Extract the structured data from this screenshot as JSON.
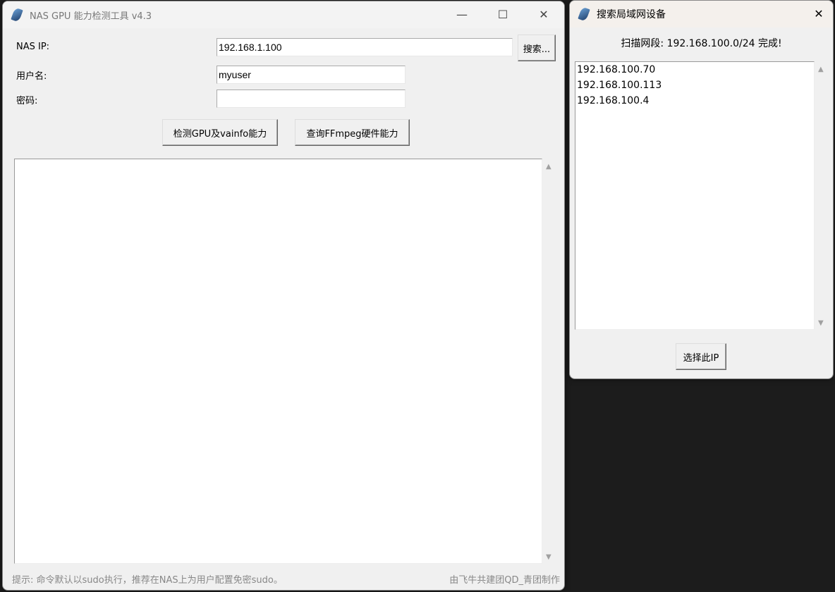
{
  "main": {
    "title": "NAS GPU 能力检测工具 v4.3",
    "controls": {
      "minimize": "—",
      "maximize": "☐",
      "close": "✕"
    },
    "nas_ip_label": "NAS IP:",
    "nas_ip_value": "192.168.1.100",
    "search_button": "搜索...",
    "username_label": "用户名:",
    "username_value": "myuser",
    "password_label": "密码:",
    "password_value": "",
    "detect_gpu_button": "检测GPU及vainfo能力",
    "ffmpeg_button": "查询FFmpeg硬件能力",
    "output_text": "",
    "hint": "提示: 命令默认以sudo执行，推荐在NAS上为用户配置免密sudo。",
    "credit": "由飞牛共建团QD_青团制作"
  },
  "dialog": {
    "title": "搜索局域网设备",
    "close": "✕",
    "status": "扫描网段: 192.168.100.0/24 完成!",
    "results": [
      "192.168.100.70",
      "192.168.100.113",
      "192.168.100.4"
    ],
    "select_button": "选择此IP"
  }
}
